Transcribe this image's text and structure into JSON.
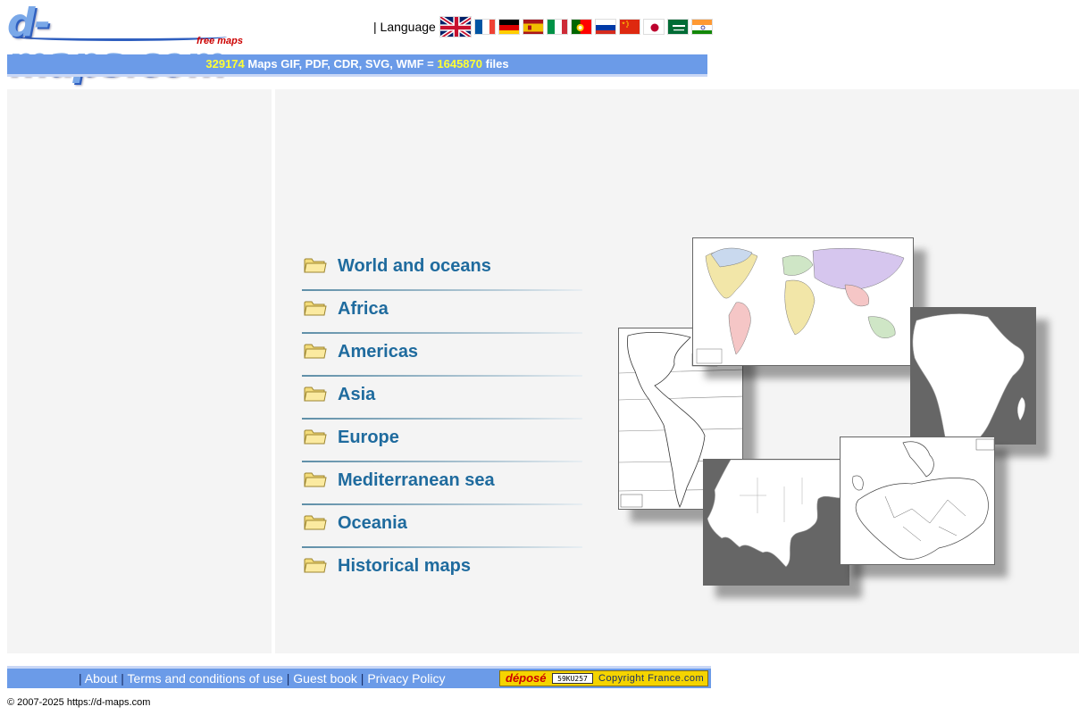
{
  "header": {
    "logo_text": "d-maps.com",
    "logo_sub": "free maps",
    "language_label": "| Language",
    "languages": [
      "english-flag",
      "french-flag",
      "german-flag",
      "spanish-flag",
      "italian-flag",
      "portuguese-flag",
      "russian-flag",
      "chinese-flag",
      "japanese-flag",
      "arabic-flag",
      "indian-flag"
    ]
  },
  "banner": {
    "maps_count": "329174",
    "maps_text": " Maps GIF, PDF, CDR, SVG, WMF = ",
    "files_count": "1645870",
    "files_text": " files"
  },
  "menu": {
    "items": [
      {
        "label": "World and oceans"
      },
      {
        "label": "Africa"
      },
      {
        "label": "Americas"
      },
      {
        "label": "Asia"
      },
      {
        "label": "Europe"
      },
      {
        "label": "Mediterranean sea"
      },
      {
        "label": "Oceania"
      },
      {
        "label": "Historical maps"
      }
    ]
  },
  "footer": {
    "sep": "|",
    "about": "About",
    "terms": "Terms and conditions of use",
    "guestbook": "Guest book",
    "privacy": "Privacy Policy",
    "badge_depose": "déposé",
    "badge_id": "59KU257",
    "badge_brand": "Copyright France.com"
  },
  "copyright_line": "© 2007-2025 https://d-maps.com",
  "colors": {
    "banner_bg": "#6b9be8",
    "banner_number": "#ffff33",
    "menu_text": "#1f6b9e",
    "panel_bg": "#f4f4f4"
  }
}
